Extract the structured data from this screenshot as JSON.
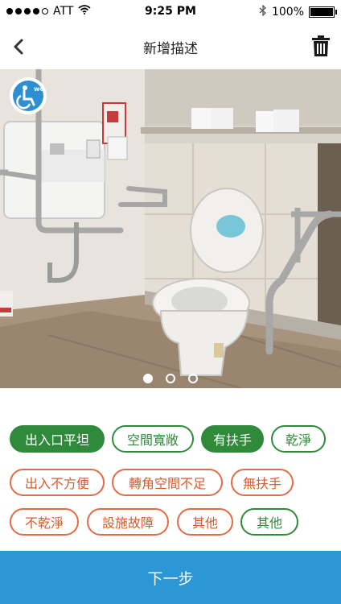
{
  "status_bar": {
    "carrier": "ATT",
    "time": "9:25 PM",
    "battery_text": "100%",
    "battery_level": 1.0,
    "signal_bars_filled": 4,
    "signal_bars_total": 5,
    "icons": [
      "signal-icon",
      "wifi-icon",
      "bluetooth-icon",
      "battery-icon"
    ]
  },
  "navbar": {
    "title": "新增描述",
    "back_icon": "chevron-left-icon",
    "delete_icon": "trash-icon"
  },
  "carousel": {
    "badge_icon": "wheelchair-wc-icon",
    "photo_subject": "accessible-toilet",
    "page_count": 3,
    "active_index": 0
  },
  "tags": [
    {
      "label": "出入口平坦",
      "style": "green-solid"
    },
    {
      "label": "空間寬敞",
      "style": "green-outline"
    },
    {
      "label": "有扶手",
      "style": "green-solid"
    },
    {
      "label": "乾淨",
      "style": "green-outline"
    },
    {
      "label": "出入不方便",
      "style": "red-outline"
    },
    {
      "label": "轉角空間不足",
      "style": "red-outline"
    },
    {
      "label": "無扶手",
      "style": "red-outline"
    },
    {
      "label": "不乾淨",
      "style": "red-outline"
    },
    {
      "label": "設施故障",
      "style": "red-outline"
    },
    {
      "label": "其他",
      "style": "red-outline"
    },
    {
      "label": "其他",
      "style": "green-outline"
    }
  ],
  "next_button": {
    "label": "下一步"
  },
  "colors": {
    "accent_blue": "#2b97d4",
    "positive_green": "#2f8a3a",
    "negative_red": "#e06d45"
  }
}
